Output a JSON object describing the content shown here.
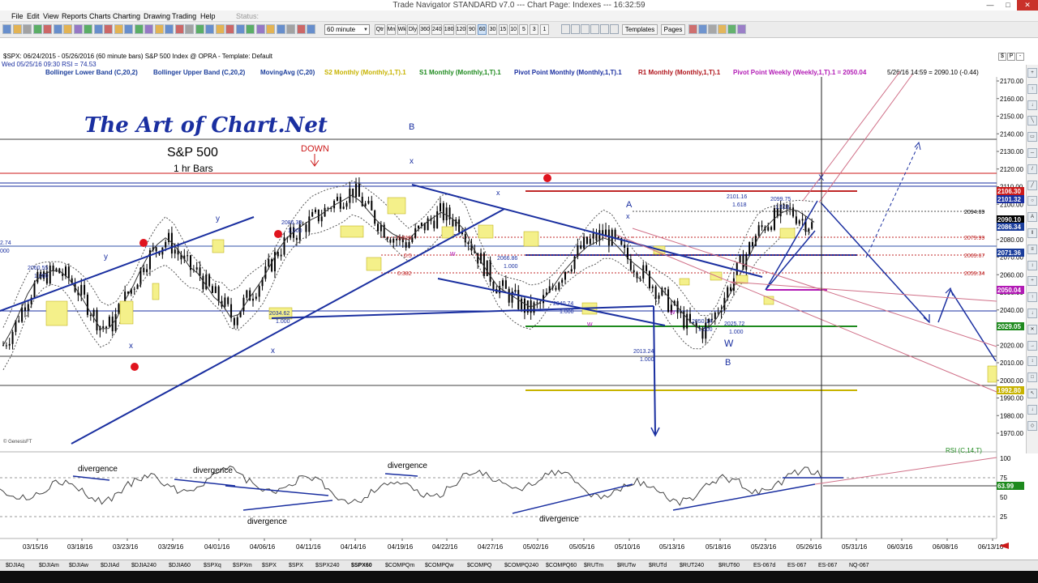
{
  "window": {
    "title": "Trade Navigator STANDARD v7.0  ---  Chart Page: Indexes --- 16:32:59"
  },
  "menu": [
    "File",
    "Edit",
    "View",
    "Reports",
    "Charts",
    "Charting",
    "Drawing",
    "Trading",
    "Help"
  ],
  "status_label": "Status:",
  "toolbar": {
    "bar_period": "60 minute",
    "timeframes": [
      "Qtr",
      "Mn",
      "Wk",
      "Dly",
      "360",
      "240",
      "180",
      "120",
      "90",
      "60",
      "30",
      "15",
      "10",
      "5",
      "3",
      "1"
    ],
    "active_timeframe": "60",
    "templates_label": "Templates",
    "pages_label": "Pages"
  },
  "chart": {
    "header_line1": "$SPX:  06/24/2015 - 05/26/2016  (60 minute bars)   S&P 500 Index @ OPRA  - Template: Default",
    "header_line2": "Wed 05/25/16 09:30   RSI = 74.53",
    "corner_buttons": [
      "$",
      "P",
      "-"
    ],
    "indicators": [
      {
        "label": "Bollinger Lower Band (C,20,2)",
        "color": "#1a3d9b"
      },
      {
        "label": "Bollinger Upper Band (C,20,2)",
        "color": "#1a3d9b"
      },
      {
        "label": "MovingAvg (C,20)",
        "color": "#1a3d9b"
      },
      {
        "label": "S2 Monthly (Monthly,1,T).1",
        "color": "#c7b300"
      },
      {
        "label": "S1 Monthly (Monthly,1,T).1",
        "color": "#1e8a1e"
      },
      {
        "label": "Pivot Point Monthly (Monthly,1,T).1",
        "color": "#1a2fa0"
      },
      {
        "label": "R1 Monthly (Monthly,1,T).1",
        "color": "#b0141b"
      },
      {
        "label": "Pivot Point Weekly (Weekly,1,T).1 = 2050.04",
        "color": "#b21ab5"
      }
    ],
    "crosshair_readout": "5/26/16 14:59 = 2090.10 (-0.44)",
    "brand_title": "The Art of Chart.Net",
    "subtitle": "S&P 500",
    "bars_caption": "1 hr Bars",
    "down_label": "DOWN",
    "copyright": "© GenesisFT",
    "price_axis": [
      "2170.00",
      "2160.00",
      "2150.00",
      "2140.00",
      "2130.00",
      "2120.00",
      "2110.00",
      "2100.00",
      "2090.00",
      "2080.00",
      "2070.00",
      "2060.00",
      "2050.00",
      "2040.00",
      "2030.00",
      "2020.00",
      "2010.00",
      "2000.00",
      "1990.00",
      "1980.00",
      "1970.00"
    ],
    "price_boxes": [
      {
        "text": "2106.30",
        "color": "#cc1a1a"
      },
      {
        "text": "2101.32",
        "color": "#1a2fa0"
      },
      {
        "text": "2090.10",
        "color": "#000000"
      },
      {
        "text": "2086.34",
        "color": "#1a3d9b"
      },
      {
        "text": "2071.36",
        "color": "#1a3d9b"
      },
      {
        "text": "2050.04",
        "color": "#b21ab5"
      },
      {
        "text": "2029.05",
        "color": "#1e8a1e"
      },
      {
        "text": "1992.80",
        "color": "#c7b300"
      }
    ],
    "level_labels": [
      "2094.69",
      "2079.99",
      "2069.67",
      "2059.34"
    ],
    "swing_labels": [
      {
        "text": "2060.55"
      },
      {
        "text": "1.000"
      },
      {
        "text": "2086.38"
      },
      {
        "text": "1.000"
      },
      {
        "text": "2034.62"
      },
      {
        "text": "1.000"
      },
      {
        "text": "2101.16"
      },
      {
        "text": "1.618"
      },
      {
        "text": "2099.75"
      },
      {
        "text": "1.618"
      },
      {
        "text": "2066.86"
      },
      {
        "text": "1.000"
      },
      {
        "text": "2040.74"
      },
      {
        "text": "1.000"
      },
      {
        "text": "2050.14"
      },
      {
        "text": "1.000"
      },
      {
        "text": "2025.72"
      },
      {
        "text": "1.000"
      },
      {
        "text": "2013.24"
      },
      {
        "text": "1.000"
      },
      {
        "text": "0.618"
      },
      {
        "text": "0.5"
      },
      {
        "text": "0.382"
      },
      {
        "text": "2.74"
      },
      {
        "text": "000"
      }
    ],
    "wave_labels": [
      "B",
      "x",
      "A",
      "x",
      "x",
      "W",
      "B",
      "w",
      "w",
      "w",
      "y",
      "y",
      "x",
      "x",
      "X",
      "y"
    ],
    "date_axis": [
      "03/15/16",
      "03/18/16",
      "03/23/16",
      "03/29/16",
      "04/01/16",
      "04/06/16",
      "04/11/16",
      "04/14/16",
      "04/19/16",
      "04/22/16",
      "04/27/16",
      "05/02/16",
      "05/05/16",
      "05/10/16",
      "05/13/16",
      "05/18/16",
      "05/23/16",
      "05/26/16",
      "05/31/16",
      "06/03/16",
      "06/08/16",
      "06/13/16"
    ],
    "rsi": {
      "label": "RSI (C,14,T)",
      "axis": [
        "100",
        "75",
        "50",
        "25"
      ],
      "value_box": "63.99",
      "divergence_labels": [
        "divergence",
        "divergence",
        "divergence",
        "divergence",
        "divergence"
      ]
    }
  },
  "symbol_tabs": [
    "$DJIAq",
    "$DJIAm",
    "$DJIAw",
    "$DJIAd",
    "$DJIA240",
    "$DJIA60",
    "$SPXq",
    "$SPXm",
    "$SPX",
    "$SPX",
    "$SPX240",
    "$SPX60",
    "$COMPQm",
    "$COMPQw",
    "$COMPQ",
    "$COMPQ240",
    "$COMPQ60",
    "$RUTm",
    "$RUTw",
    "$RUTd",
    "$RUT240",
    "$RUT60",
    "ES-067d",
    "ES-067",
    "ES-067",
    "NQ-067"
  ],
  "active_symbol_tab": 11
}
